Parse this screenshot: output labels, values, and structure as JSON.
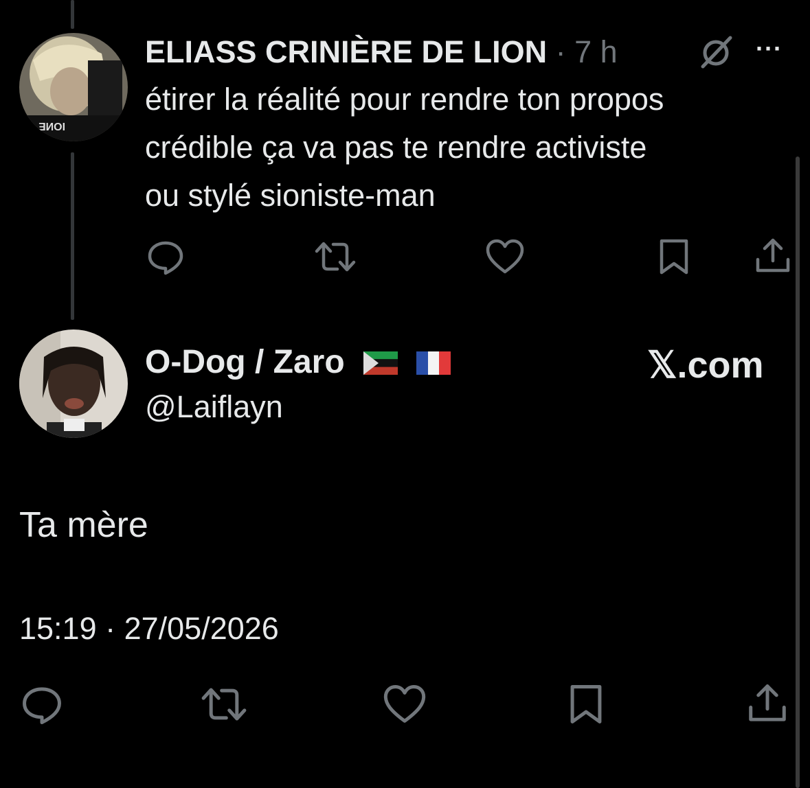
{
  "reply": {
    "author_name": "ELIASS CRINIÈRE DE LION",
    "separator": "·",
    "time": "7 h",
    "text_lines": [
      "étirer la réalité pour rendre ton propos",
      "crédible ça va pas te rendre activiste",
      "ou stylé sioniste-man"
    ],
    "more_label": "···"
  },
  "main": {
    "author_name": "O-Dog / Zaro",
    "flags": [
      "🏴",
      "🇫🇷"
    ],
    "handle": "@Laiflayn",
    "brand": "𝕏.com",
    "text": "Ta mère",
    "timestamp": "15:19 · 27/05/2026"
  },
  "colors": {
    "background": "#000000",
    "text": "#e7e9ea",
    "muted": "#71767b",
    "thread_line": "#333639"
  }
}
